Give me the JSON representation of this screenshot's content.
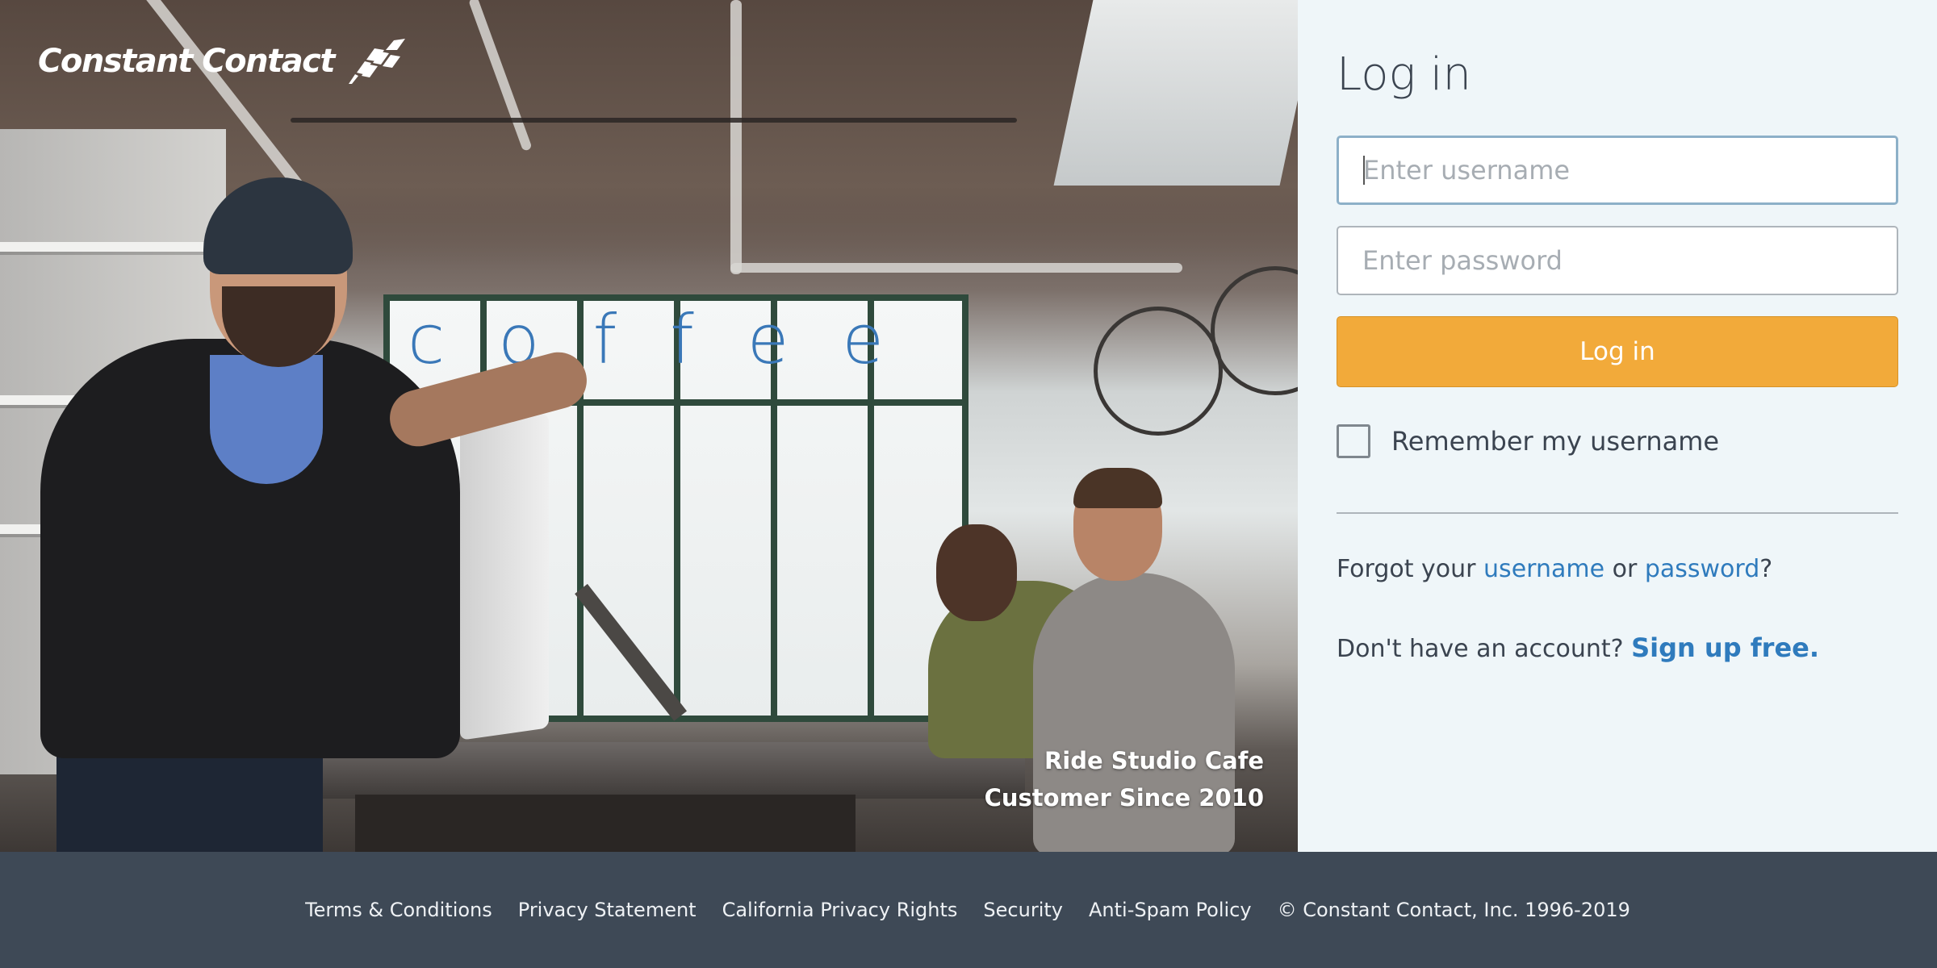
{
  "brand": {
    "name": "Constant Contact"
  },
  "hero": {
    "caption_line1": "Ride Studio Cafe",
    "caption_line2": "Customer Since 2010",
    "window_text": "coffee"
  },
  "login": {
    "title": "Log in",
    "username_placeholder": "Enter username",
    "password_placeholder": "Enter password",
    "submit_label": "Log in",
    "remember_label": "Remember my username",
    "forgot_prefix": "Forgot your ",
    "forgot_username": "username",
    "forgot_or": " or ",
    "forgot_password": "password",
    "forgot_suffix": "?",
    "signup_prefix": "Don't have an account? ",
    "signup_link": "Sign up free."
  },
  "footer": {
    "links": [
      "Terms & Conditions",
      "Privacy Statement",
      "California Privacy Rights",
      "Security",
      "Anti-Spam Policy"
    ],
    "copyright": "© Constant Contact, Inc. 1996-2019"
  },
  "colors": {
    "accent_button": "#f2aa3a",
    "link": "#2f7bbd",
    "panel_bg": "#eff6f9",
    "footer_bg": "#3e4956"
  }
}
